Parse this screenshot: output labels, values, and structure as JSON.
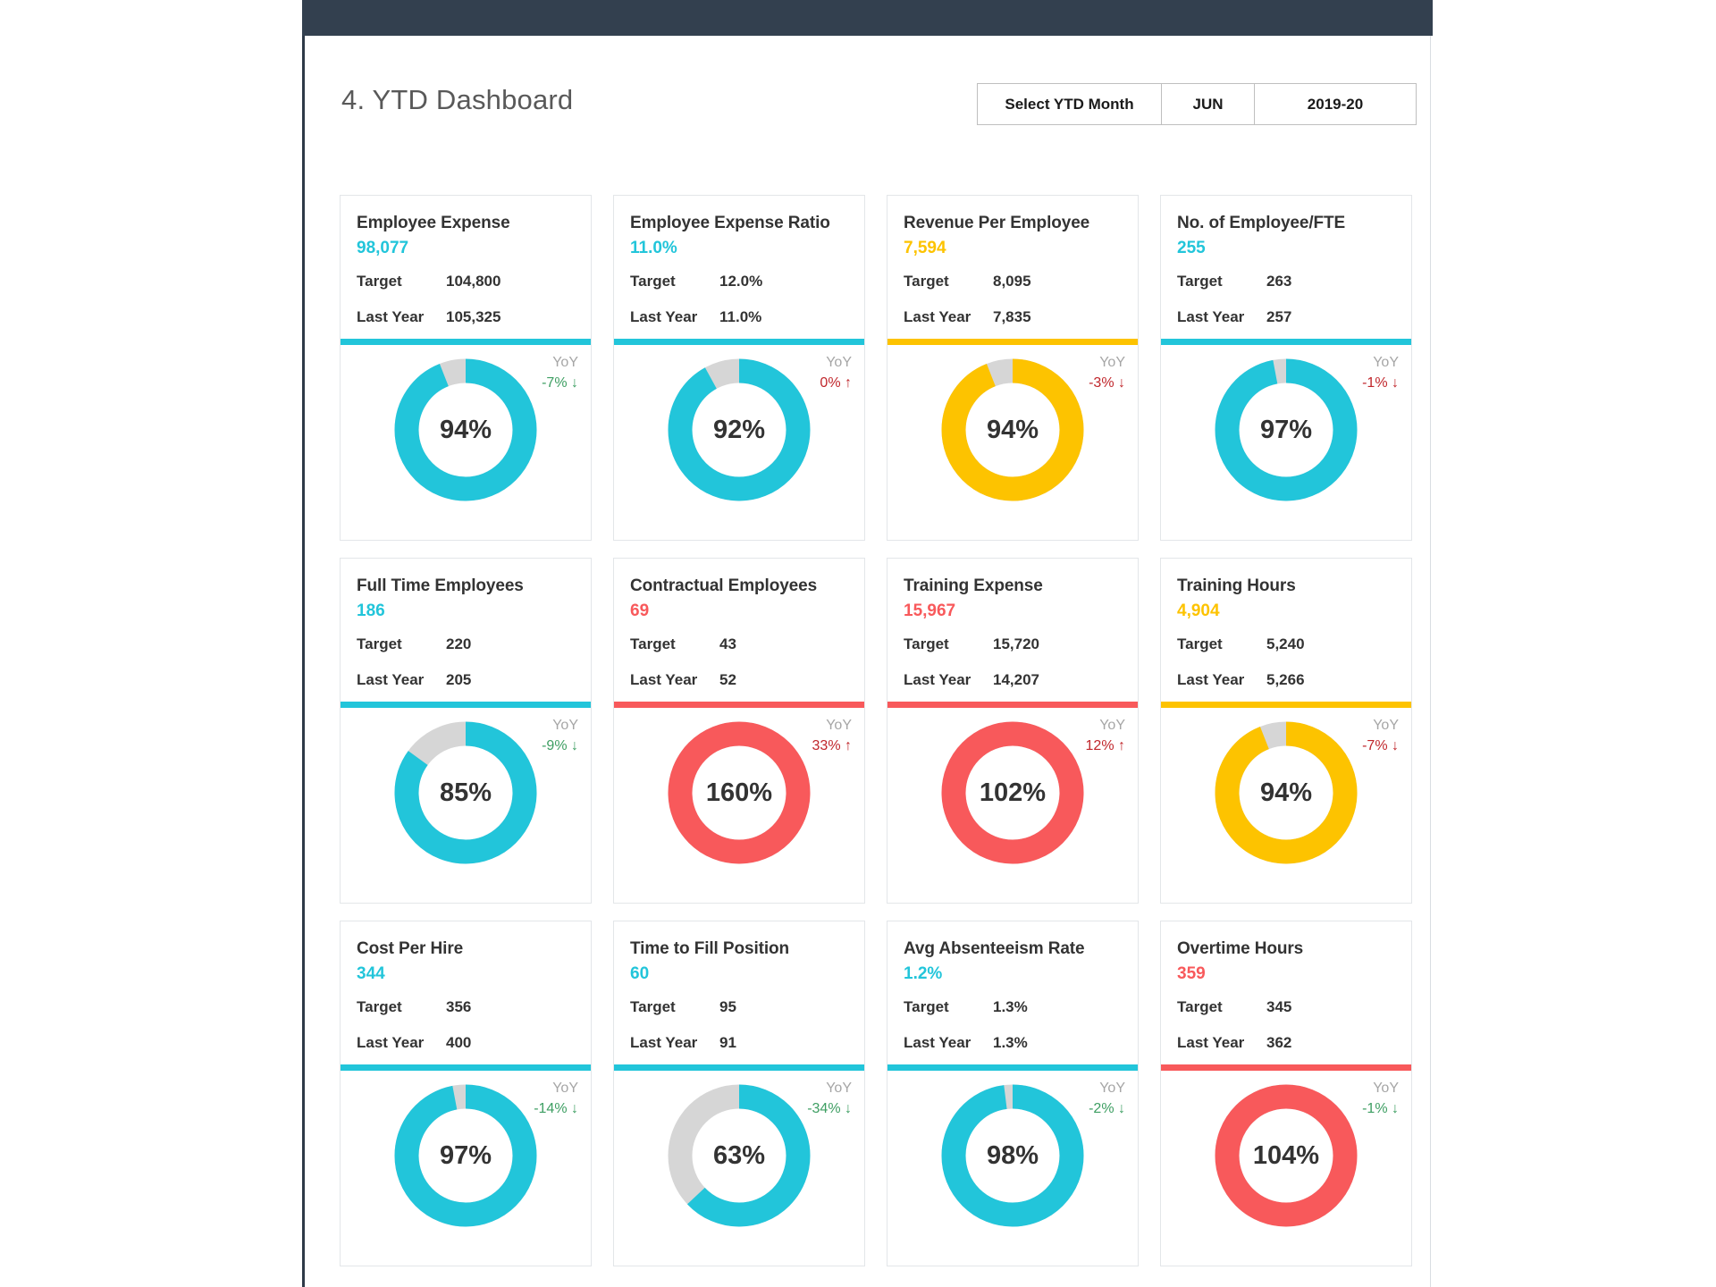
{
  "header": {
    "title": "4. YTD Dashboard",
    "selector": {
      "label": "Select YTD Month",
      "month": "JUN",
      "year": "2019-20"
    }
  },
  "labels": {
    "target": "Target",
    "last_year": "Last Year",
    "yoy": "YoY"
  },
  "colors": {
    "teal": "#22c5da",
    "yellow": "#fdc300",
    "red": "#f8595b",
    "grey_track": "#d6d6d6",
    "green_text": "#3d9e62",
    "red_text": "#c0262b",
    "navy": "#33404f"
  },
  "chart_data": {
    "type": "pie",
    "title": "4. YTD Dashboard",
    "note": "Twelve KPI donut gauges showing actual-vs-target achievement percentage",
    "cards": [
      {
        "title": "Employee Expense",
        "value": "98,077",
        "target": "104,800",
        "last_year": "105,325",
        "percent_label": "94%",
        "percent": 94,
        "status": "teal",
        "yoy": "-7% ↓",
        "yoy_tone": "green"
      },
      {
        "title": "Employee Expense Ratio",
        "value": "11.0%",
        "target": "12.0%",
        "last_year": "11.0%",
        "percent_label": "92%",
        "percent": 92,
        "status": "teal",
        "yoy": "0% ↑",
        "yoy_tone": "red"
      },
      {
        "title": "Revenue Per Employee",
        "value": "7,594",
        "target": "8,095",
        "last_year": "7,835",
        "percent_label": "94%",
        "percent": 94,
        "status": "yellow",
        "yoy": "-3% ↓",
        "yoy_tone": "red"
      },
      {
        "title": "No. of Employee/FTE",
        "value": "255",
        "target": "263",
        "last_year": "257",
        "percent_label": "97%",
        "percent": 97,
        "status": "teal",
        "yoy": "-1% ↓",
        "yoy_tone": "red"
      },
      {
        "title": "Full Time Employees",
        "value": "186",
        "target": "220",
        "last_year": "205",
        "percent_label": "85%",
        "percent": 85,
        "status": "teal",
        "yoy": "-9% ↓",
        "yoy_tone": "green"
      },
      {
        "title": "Contractual Employees",
        "value": "69",
        "target": "43",
        "last_year": "52",
        "percent_label": "160%",
        "percent": 160,
        "status": "red",
        "yoy": "33% ↑",
        "yoy_tone": "red"
      },
      {
        "title": "Training Expense",
        "value": "15,967",
        "target": "15,720",
        "last_year": "14,207",
        "percent_label": "102%",
        "percent": 102,
        "status": "red",
        "yoy": "12% ↑",
        "yoy_tone": "red"
      },
      {
        "title": "Training Hours",
        "value": "4,904",
        "target": "5,240",
        "last_year": "5,266",
        "percent_label": "94%",
        "percent": 94,
        "status": "yellow",
        "yoy": "-7% ↓",
        "yoy_tone": "red"
      },
      {
        "title": "Cost Per Hire",
        "value": "344",
        "target": "356",
        "last_year": "400",
        "percent_label": "97%",
        "percent": 97,
        "status": "teal",
        "yoy": "-14% ↓",
        "yoy_tone": "green"
      },
      {
        "title": "Time to Fill Position",
        "value": "60",
        "target": "95",
        "last_year": "91",
        "percent_label": "63%",
        "percent": 63,
        "status": "teal",
        "yoy": "-34% ↓",
        "yoy_tone": "green"
      },
      {
        "title": "Avg Absenteeism Rate",
        "value": "1.2%",
        "target": "1.3%",
        "last_year": "1.3%",
        "percent_label": "98%",
        "percent": 98,
        "status": "teal",
        "yoy": "-2% ↓",
        "yoy_tone": "green"
      },
      {
        "title": "Overtime Hours",
        "value": "359",
        "target": "345",
        "last_year": "362",
        "percent_label": "104%",
        "percent": 104,
        "status": "red",
        "yoy": "-1% ↓",
        "yoy_tone": "green"
      }
    ]
  }
}
